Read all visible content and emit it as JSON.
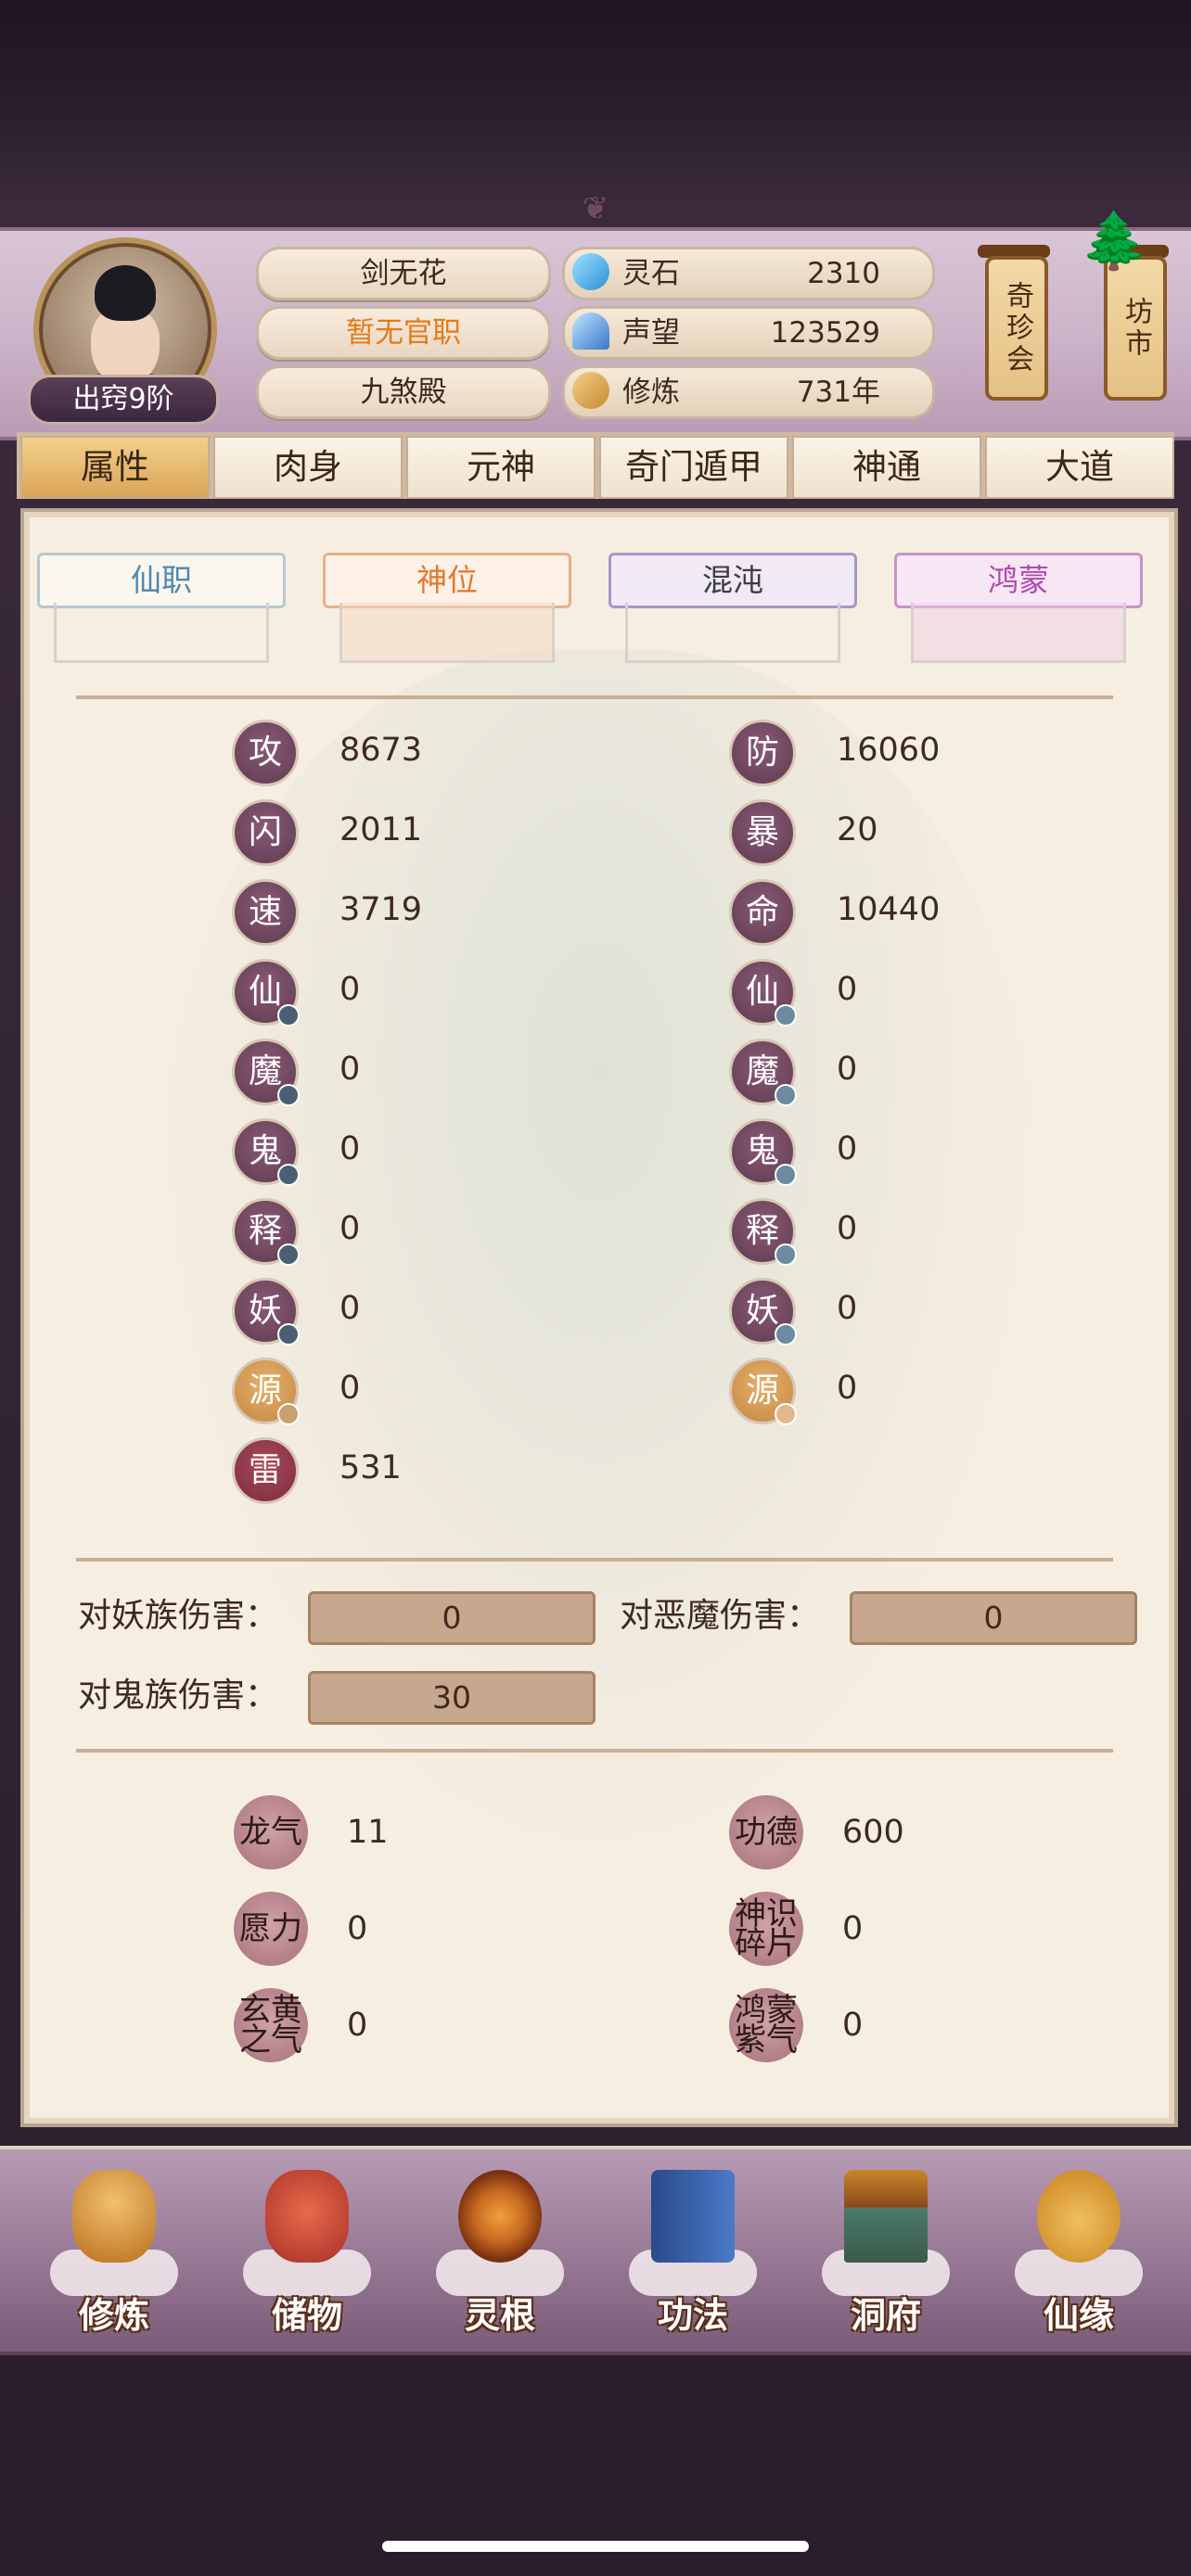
{
  "header": {
    "avatar_rank": "出窍9阶",
    "name": "剑无花",
    "title": "暂无官职",
    "sect": "九煞殿",
    "resources": [
      {
        "icon": "spirit-stone-icon",
        "label": "灵石",
        "value": "2310"
      },
      {
        "icon": "reputation-icon",
        "label": "声望",
        "value": "123529"
      },
      {
        "icon": "cultivation-icon",
        "label": "修炼",
        "value": "731年"
      }
    ],
    "lanterns": [
      "奇珍会",
      "坊市"
    ]
  },
  "tabs": [
    "属性",
    "肉身",
    "元神",
    "奇门遁甲",
    "神通",
    "大道"
  ],
  "active_tab": "属性",
  "subtabs": [
    "仙职",
    "神位",
    "混沌",
    "鸿蒙"
  ],
  "stats_left": [
    {
      "icon": "攻",
      "value": "8673"
    },
    {
      "icon": "闪",
      "value": "2011"
    },
    {
      "icon": "速",
      "value": "3719"
    },
    {
      "icon": "仙",
      "value": "0"
    },
    {
      "icon": "魔",
      "value": "0"
    },
    {
      "icon": "鬼",
      "value": "0"
    },
    {
      "icon": "释",
      "value": "0"
    },
    {
      "icon": "妖",
      "value": "0"
    },
    {
      "icon": "源",
      "value": "0"
    },
    {
      "icon": "雷",
      "value": "531"
    }
  ],
  "stats_right": [
    {
      "icon": "防",
      "value": "16060"
    },
    {
      "icon": "暴",
      "value": "20"
    },
    {
      "icon": "命",
      "value": "10440"
    },
    {
      "icon": "仙",
      "value": "0"
    },
    {
      "icon": "魔",
      "value": "0"
    },
    {
      "icon": "鬼",
      "value": "0"
    },
    {
      "icon": "释",
      "value": "0"
    },
    {
      "icon": "妖",
      "value": "0"
    },
    {
      "icon": "源",
      "value": "0"
    }
  ],
  "damage": [
    {
      "label": "对妖族伤害：",
      "value": "0"
    },
    {
      "label": "对恶魔伤害：",
      "value": "0"
    },
    {
      "label": "对鬼族伤害：",
      "value": "30"
    }
  ],
  "misc": [
    {
      "icon": "龙气",
      "value": "11"
    },
    {
      "icon": "功德",
      "value": "600"
    },
    {
      "icon": "愿力",
      "value": "0"
    },
    {
      "icon": "神识碎片",
      "value": "0"
    },
    {
      "icon": "玄黄之气",
      "value": "0"
    },
    {
      "icon": "鸿蒙紫气",
      "value": "0"
    }
  ],
  "bottom_nav": [
    "修炼",
    "储物",
    "灵根",
    "功法",
    "洞府",
    "仙缘"
  ]
}
